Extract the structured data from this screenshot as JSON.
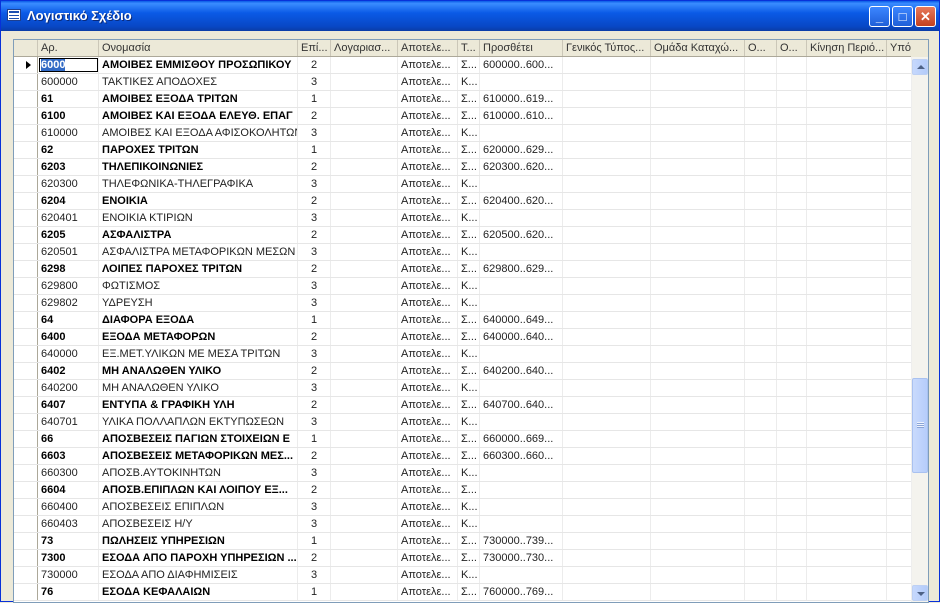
{
  "window": {
    "title": "Λογιστικό Σχέδιο"
  },
  "title_buttons": {
    "minimize": "_",
    "maximize": "□",
    "close": "✕"
  },
  "columns": [
    "Αρ.",
    "Ονομασία",
    "Επί...",
    "Λογαριασ...",
    "Αποτελε...",
    "Τ...",
    "Προσθέτει",
    "Γενικός Τύπος...",
    "Ομάδα Καταχώ...",
    "Ο...",
    "Ο...",
    "Κίνηση Περιό...",
    "Υπό."
  ],
  "rows": [
    {
      "no": "6000",
      "name": "ΑΜΟΙΒΕΣ ΕΜΜΙΣΘΟΥ ΠΡΟΣΩΠΙΚΟΥ",
      "level": "2",
      "type": "Αποτελε...",
      "t": "Σ...",
      "totaling": "600000..600...",
      "bold": true,
      "selected": true
    },
    {
      "no": "600000",
      "name": "ΤΑΚΤΙΚΕΣ ΑΠΟΔΟΧΕΣ",
      "level": "3",
      "type": "Αποτελε...",
      "t": "Κ...",
      "totaling": "",
      "bold": false
    },
    {
      "no": "61",
      "name": "ΑΜΟΙΒΕΣ ΕΞΟΔΑ ΤΡΙΤΩΝ",
      "level": "1",
      "type": "Αποτελε...",
      "t": "Σ...",
      "totaling": "610000..619...",
      "bold": true
    },
    {
      "no": "6100",
      "name": "ΑΜΟΙΒΕΣ ΚΑΙ ΕΞΟΔΑ ΕΛΕΥΘ. ΕΠΑΓ",
      "level": "2",
      "type": "Αποτελε...",
      "t": "Σ...",
      "totaling": "610000..610...",
      "bold": true
    },
    {
      "no": "610000",
      "name": "ΑΜΟΙΒΕΣ ΚΑΙ ΕΞΟΔΑ ΑΦΙΣΟΚΟΛΗΤΩΝ",
      "level": "3",
      "type": "Αποτελε...",
      "t": "Κ...",
      "totaling": "",
      "bold": false
    },
    {
      "no": "62",
      "name": "ΠΑΡΟΧΕΣ ΤΡΙΤΩΝ",
      "level": "1",
      "type": "Αποτελε...",
      "t": "Σ...",
      "totaling": "620000..629...",
      "bold": true
    },
    {
      "no": "6203",
      "name": "ΤΗΛΕΠΙΚΟΙΝΩΝΙΕΣ",
      "level": "2",
      "type": "Αποτελε...",
      "t": "Σ...",
      "totaling": "620300..620...",
      "bold": true
    },
    {
      "no": "620300",
      "name": "ΤΗΛΕΦΩΝΙΚΑ-ΤΗΛΕΓΡΑΦΙΚΑ",
      "level": "3",
      "type": "Αποτελε...",
      "t": "Κ...",
      "totaling": "",
      "bold": false
    },
    {
      "no": "6204",
      "name": "ΕΝΟΙΚΙΑ",
      "level": "2",
      "type": "Αποτελε...",
      "t": "Σ...",
      "totaling": "620400..620...",
      "bold": true
    },
    {
      "no": "620401",
      "name": "ΕΝΟΙΚΙΑ ΚΤΙΡΙΩΝ",
      "level": "3",
      "type": "Αποτελε...",
      "t": "Κ...",
      "totaling": "",
      "bold": false
    },
    {
      "no": "6205",
      "name": "ΑΣΦΑΛΙΣΤΡΑ",
      "level": "2",
      "type": "Αποτελε...",
      "t": "Σ...",
      "totaling": "620500..620...",
      "bold": true
    },
    {
      "no": "620501",
      "name": "ΑΣΦΑΛΙΣΤΡΑ ΜΕΤΑΦΟΡΙΚΩΝ ΜΕΣΩΝ",
      "level": "3",
      "type": "Αποτελε...",
      "t": "Κ...",
      "totaling": "",
      "bold": false
    },
    {
      "no": "6298",
      "name": "ΛΟΙΠΕΣ ΠΑΡΟΧΕΣ ΤΡΙΤΩΝ",
      "level": "2",
      "type": "Αποτελε...",
      "t": "Σ...",
      "totaling": "629800..629...",
      "bold": true
    },
    {
      "no": "629800",
      "name": "ΦΩΤΙΣΜΟΣ",
      "level": "3",
      "type": "Αποτελε...",
      "t": "Κ...",
      "totaling": "",
      "bold": false
    },
    {
      "no": "629802",
      "name": "ΥΔΡΕΥΣΗ",
      "level": "3",
      "type": "Αποτελε...",
      "t": "Κ...",
      "totaling": "",
      "bold": false
    },
    {
      "no": "64",
      "name": "ΔΙΑΦΟΡΑ ΕΞΟΔΑ",
      "level": "1",
      "type": "Αποτελε...",
      "t": "Σ...",
      "totaling": "640000..649...",
      "bold": true
    },
    {
      "no": "6400",
      "name": "ΕΞΟΔΑ ΜΕΤΑΦΟΡΩΝ",
      "level": "2",
      "type": "Αποτελε...",
      "t": "Σ...",
      "totaling": "640000..640...",
      "bold": true
    },
    {
      "no": "640000",
      "name": "ΕΞ.ΜΕΤ.ΥΛΙΚΩΝ ΜΕ ΜΕΣΑ ΤΡΙΤΩΝ",
      "level": "3",
      "type": "Αποτελε...",
      "t": "Κ...",
      "totaling": "",
      "bold": false
    },
    {
      "no": "6402",
      "name": "ΜΗ ΑΝΑΛΩΘΕΝ ΥΛΙΚΟ",
      "level": "2",
      "type": "Αποτελε...",
      "t": "Σ...",
      "totaling": "640200..640...",
      "bold": true
    },
    {
      "no": "640200",
      "name": "ΜΗ ΑΝΑΛΩΘΕΝ ΥΛΙΚΟ",
      "level": "3",
      "type": "Αποτελε...",
      "t": "Κ...",
      "totaling": "",
      "bold": false
    },
    {
      "no": "6407",
      "name": "ΕΝΤΥΠΑ & ΓΡΑΦΙΚΗ ΥΛΗ",
      "level": "2",
      "type": "Αποτελε...",
      "t": "Σ...",
      "totaling": "640700..640...",
      "bold": true
    },
    {
      "no": "640701",
      "name": "ΥΛΙΚΑ ΠΟΛΛΑΠΛΩΝ ΕΚΤΥΠΩΣΕΩΝ",
      "level": "3",
      "type": "Αποτελε...",
      "t": "Κ...",
      "totaling": "",
      "bold": false
    },
    {
      "no": "66",
      "name": "ΑΠΟΣΒΕΣΕΙΣ ΠΑΓΙΩΝ ΣΤΟΙΧΕΙΩΝ Ε",
      "level": "1",
      "type": "Αποτελε...",
      "t": "Σ...",
      "totaling": "660000..669...",
      "bold": true
    },
    {
      "no": "6603",
      "name": "ΑΠΟΣΒΕΣΕΙΣ ΜΕΤΑΦΟΡΙΚΩΝ ΜΕΣ...",
      "level": "2",
      "type": "Αποτελε...",
      "t": "Σ...",
      "totaling": "660300..660...",
      "bold": true
    },
    {
      "no": "660300",
      "name": "ΑΠΟΣΒ.ΑΥΤΟΚΙΝΗΤΩΝ",
      "level": "3",
      "type": "Αποτελε...",
      "t": "Κ...",
      "totaling": "",
      "bold": false
    },
    {
      "no": "6604",
      "name": "ΑΠΟΣΒ.ΕΠΙΠΛΩΝ ΚΑΙ ΛΟΙΠΟΥ ΕΞ...",
      "level": "2",
      "type": "Αποτελε...",
      "t": "Σ...",
      "totaling": "",
      "bold": true
    },
    {
      "no": "660400",
      "name": "ΑΠΟΣΒΕΣΕΙΣ ΕΠΙΠΛΩΝ",
      "level": "3",
      "type": "Αποτελε...",
      "t": "Κ...",
      "totaling": "",
      "bold": false
    },
    {
      "no": "660403",
      "name": "ΑΠΟΣΒΕΣΕΙΣ Η/Υ",
      "level": "3",
      "type": "Αποτελε...",
      "t": "Κ...",
      "totaling": "",
      "bold": false
    },
    {
      "no": "73",
      "name": "ΠΩΛΗΣΕΙΣ ΥΠΗΡΕΣΙΩΝ",
      "level": "1",
      "type": "Αποτελε...",
      "t": "Σ...",
      "totaling": "730000..739...",
      "bold": true
    },
    {
      "no": "7300",
      "name": "ΕΣΟΔΑ ΑΠΟ ΠΑΡΟΧΗ ΥΠΗΡΕΣΙΩΝ ...",
      "level": "2",
      "type": "Αποτελε...",
      "t": "Σ...",
      "totaling": "730000..730...",
      "bold": true
    },
    {
      "no": "730000",
      "name": "ΕΣΟΔΑ ΑΠΟ ΔΙΑΦΗΜΙΣΕΙΣ",
      "level": "3",
      "type": "Αποτελε...",
      "t": "Κ...",
      "totaling": "",
      "bold": false
    },
    {
      "no": "76",
      "name": "ΕΣΟΔΑ ΚΕΦΑΛΑΙΩΝ",
      "level": "1",
      "type": "Αποτελε...",
      "t": "Σ...",
      "totaling": "760000..769...",
      "bold": true
    }
  ]
}
